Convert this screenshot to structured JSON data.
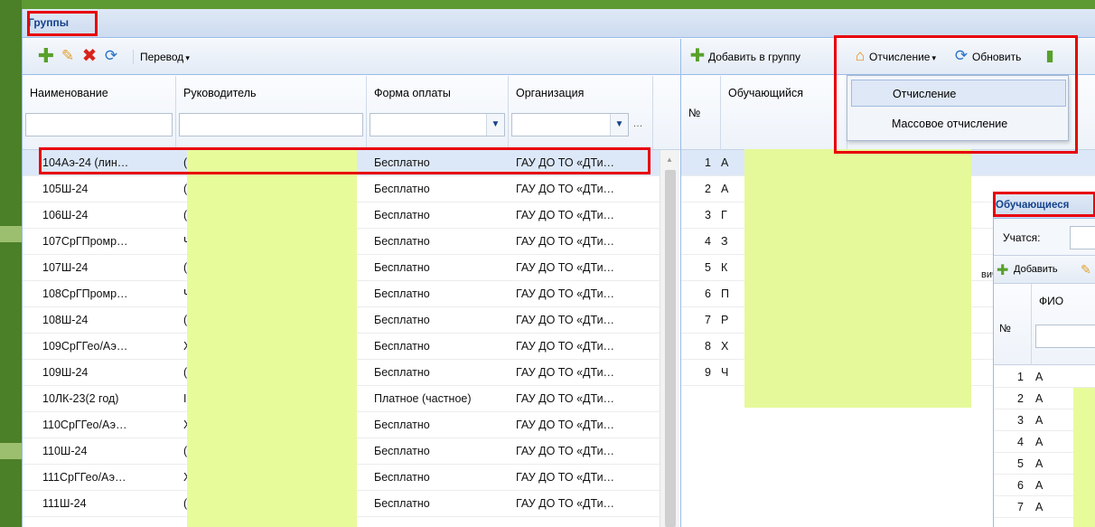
{
  "groups_panel": {
    "title": "Группы",
    "toolbar": {
      "transfer_label": "Перевод"
    },
    "columns": [
      "Наименование",
      "Руководитель",
      "Форма оплаты",
      "Организация"
    ],
    "rows": [
      {
        "name": "104Аэ-24 (лин…",
        "leader": "(",
        "payment": "Бесплатно",
        "org": "ГАУ ДО ТО «ДТи…"
      },
      {
        "name": "105Ш-24",
        "leader": "(",
        "payment": "Бесплатно",
        "org": "ГАУ ДО ТО «ДТи…"
      },
      {
        "name": "106Ш-24",
        "leader": "(",
        "payment": "Бесплатно",
        "org": "ГАУ ДО ТО «ДТи…"
      },
      {
        "name": "107СрГПромр…",
        "leader": "Ч",
        "payment": "Бесплатно",
        "org": "ГАУ ДО ТО «ДТи…"
      },
      {
        "name": "107Ш-24",
        "leader": "(",
        "payment": "Бесплатно",
        "org": "ГАУ ДО ТО «ДТи…"
      },
      {
        "name": "108СрГПромр…",
        "leader": "Ч",
        "payment": "Бесплатно",
        "org": "ГАУ ДО ТО «ДТи…"
      },
      {
        "name": "108Ш-24",
        "leader": "(",
        "payment": "Бесплатно",
        "org": "ГАУ ДО ТО «ДТи…"
      },
      {
        "name": "109СрГГео/Аэ…",
        "leader": "Х",
        "payment": "Бесплатно",
        "org": "ГАУ ДО ТО «ДТи…"
      },
      {
        "name": "109Ш-24",
        "leader": "(",
        "payment": "Бесплатно",
        "org": "ГАУ ДО ТО «ДТи…"
      },
      {
        "name": "10ЛК-23(2 год)",
        "leader": "I",
        "payment": "Платное (частное)",
        "org": "ГАУ ДО ТО «ДТи…"
      },
      {
        "name": "110СрГГео/Аэ…",
        "leader": "Х",
        "payment": "Бесплатно",
        "org": "ГАУ ДО ТО «ДТи…"
      },
      {
        "name": "110Ш-24",
        "leader": "(",
        "payment": "Бесплатно",
        "org": "ГАУ ДО ТО «ДТи…"
      },
      {
        "name": "111СрГГео/Аэ…",
        "leader": "Х",
        "payment": "Бесплатно",
        "org": "ГАУ ДО ТО «ДТи…"
      },
      {
        "name": "111Ш-24",
        "leader": "(",
        "payment": "Бесплатно",
        "org": "ГАУ ДО ТО «ДТи…"
      }
    ]
  },
  "students_panel": {
    "toolbar": {
      "add_to_group_label": "Добавить в группу",
      "expel_label": "Отчисление",
      "refresh_label": "Обновить"
    },
    "columns": [
      "№",
      "Обучающийся"
    ],
    "rows": [
      {
        "num": "1",
        "name": "А"
      },
      {
        "num": "2",
        "name": "А"
      },
      {
        "num": "3",
        "name": "Г"
      },
      {
        "num": "4",
        "name": "З"
      },
      {
        "num": "5",
        "name": "К"
      },
      {
        "num": "6",
        "name": "П"
      },
      {
        "num": "7",
        "name": "Р"
      },
      {
        "num": "8",
        "name": "Х"
      },
      {
        "num": "9",
        "name": "Ч"
      }
    ],
    "fragment_vich": "вич"
  },
  "expel_menu": {
    "items": [
      "Отчисление",
      "Массовое отчисление"
    ]
  },
  "learners_window": {
    "title": "Обучающиеся",
    "studying_label": "Учатся:",
    "add_label": "Добавить",
    "columns": [
      "№",
      "ФИО"
    ],
    "rows": [
      {
        "num": "1",
        "name": "А"
      },
      {
        "num": "2",
        "name": "А"
      },
      {
        "num": "3",
        "name": "А"
      },
      {
        "num": "4",
        "name": "А"
      },
      {
        "num": "5",
        "name": "А"
      },
      {
        "num": "6",
        "name": "А"
      },
      {
        "num": "7",
        "name": "А"
      }
    ]
  },
  "colors": {
    "accent": "#15428b",
    "highlight": "#e8000b",
    "mask": "#e8fb9a",
    "add_icon": "#6aa84f",
    "delete_icon": "#d9231b"
  }
}
